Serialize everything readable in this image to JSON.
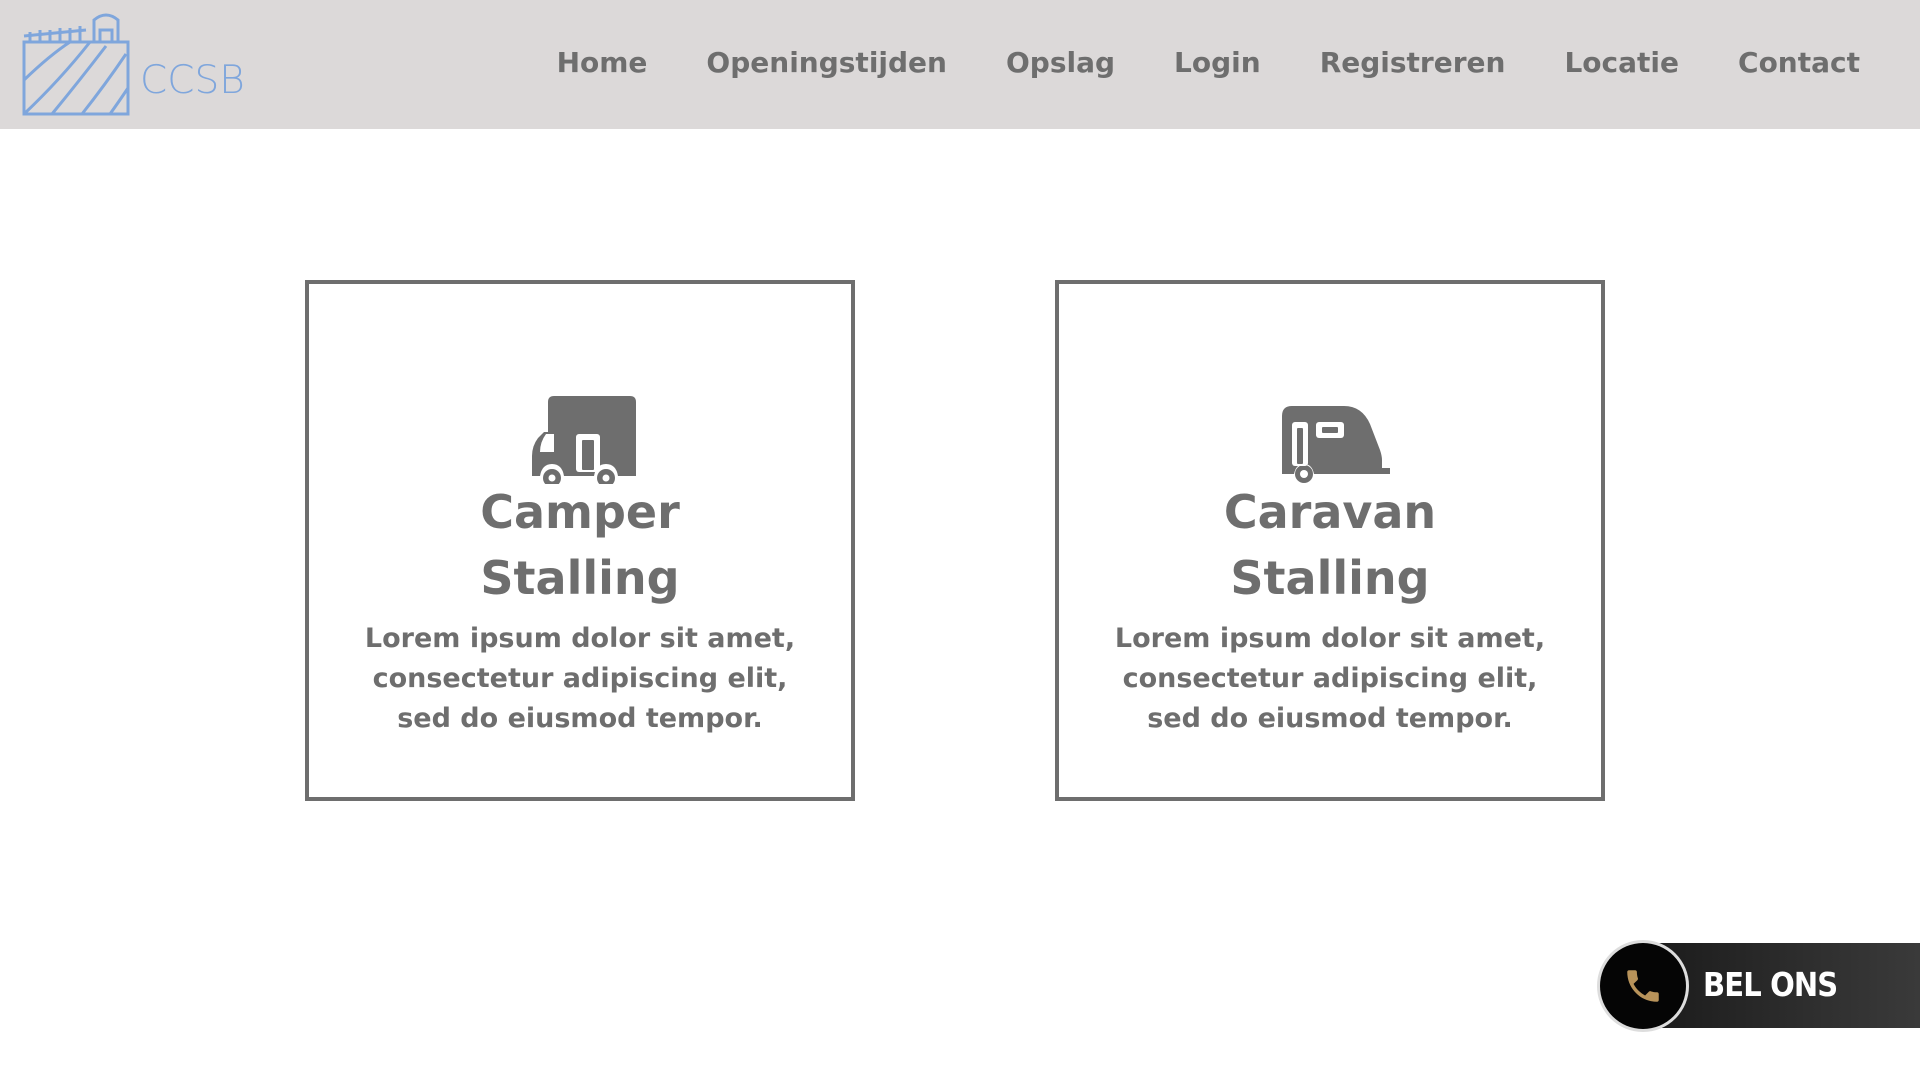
{
  "brand": {
    "name": "CCSB",
    "logo_icon": "farm-field-barn-logo",
    "logo_color": "#7fa6dc"
  },
  "nav": {
    "items": [
      {
        "label": "Home"
      },
      {
        "label": "Openingstijden"
      },
      {
        "label": "Opslag"
      },
      {
        "label": "Login"
      },
      {
        "label": "Registreren"
      },
      {
        "label": "Locatie"
      },
      {
        "label": "Contact"
      }
    ]
  },
  "cards": [
    {
      "icon": "camper-van-icon",
      "title_line1": "Camper",
      "title_line2": "Stalling",
      "desc_line1": "Lorem ipsum dolor sit amet,",
      "desc_line2": "consectetur adipiscing elit,",
      "desc_line3": "sed do eiusmod tempor."
    },
    {
      "icon": "caravan-trailer-icon",
      "title_line1": "Caravan",
      "title_line2": "Stalling",
      "desc_line1": "Lorem ipsum dolor sit amet,",
      "desc_line2": "consectetur adipiscing elit,",
      "desc_line3": "sed do eiusmod tempor."
    }
  ],
  "call_button": {
    "label": "BEL ONS",
    "icon": "phone-icon",
    "icon_color": "#b8935a"
  },
  "colors": {
    "header_bg": "#dcd9d9",
    "text_gray": "#6e6e6e"
  }
}
